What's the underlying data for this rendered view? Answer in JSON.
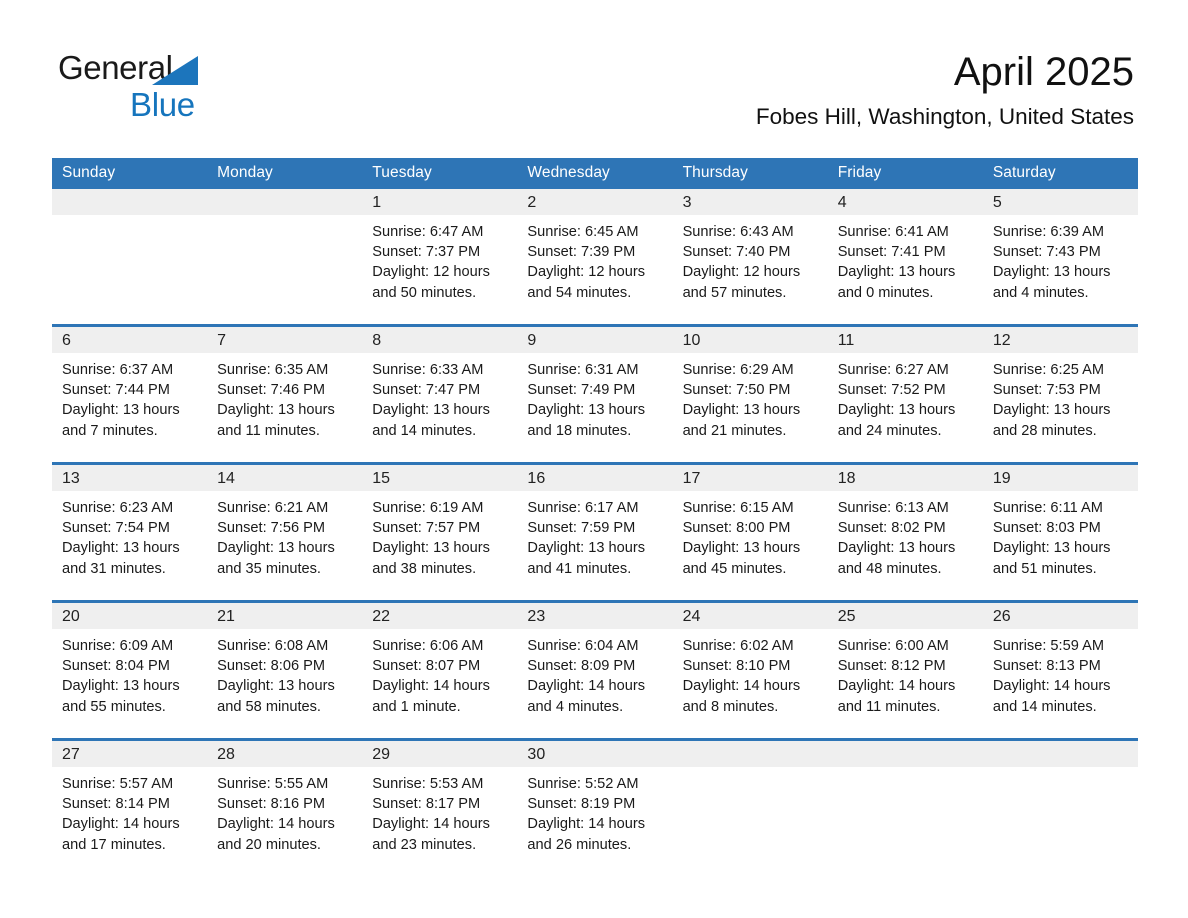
{
  "brand": {
    "name_part1": "General",
    "name_part2": "Blue",
    "triangle_color": "#1c75bc",
    "blue_color": "#1675bd"
  },
  "header": {
    "title": "April 2025",
    "subtitle": "Fobes Hill, Washington, United States"
  },
  "theme": {
    "header_blue": "#2e75b6",
    "daynum_band": "#efefef",
    "text": "#1a1a1a",
    "page_background": "#ffffff"
  },
  "weekday_headers": [
    "Sunday",
    "Monday",
    "Tuesday",
    "Wednesday",
    "Thursday",
    "Friday",
    "Saturday"
  ],
  "weeks": [
    [
      {
        "day": "",
        "sunrise": "",
        "sunset": "",
        "daylight_line1": "",
        "daylight_line2": ""
      },
      {
        "day": "",
        "sunrise": "",
        "sunset": "",
        "daylight_line1": "",
        "daylight_line2": ""
      },
      {
        "day": "1",
        "sunrise": "Sunrise: 6:47 AM",
        "sunset": "Sunset: 7:37 PM",
        "daylight_line1": "Daylight: 12 hours",
        "daylight_line2": "and 50 minutes."
      },
      {
        "day": "2",
        "sunrise": "Sunrise: 6:45 AM",
        "sunset": "Sunset: 7:39 PM",
        "daylight_line1": "Daylight: 12 hours",
        "daylight_line2": "and 54 minutes."
      },
      {
        "day": "3",
        "sunrise": "Sunrise: 6:43 AM",
        "sunset": "Sunset: 7:40 PM",
        "daylight_line1": "Daylight: 12 hours",
        "daylight_line2": "and 57 minutes."
      },
      {
        "day": "4",
        "sunrise": "Sunrise: 6:41 AM",
        "sunset": "Sunset: 7:41 PM",
        "daylight_line1": "Daylight: 13 hours",
        "daylight_line2": "and 0 minutes."
      },
      {
        "day": "5",
        "sunrise": "Sunrise: 6:39 AM",
        "sunset": "Sunset: 7:43 PM",
        "daylight_line1": "Daylight: 13 hours",
        "daylight_line2": "and 4 minutes."
      }
    ],
    [
      {
        "day": "6",
        "sunrise": "Sunrise: 6:37 AM",
        "sunset": "Sunset: 7:44 PM",
        "daylight_line1": "Daylight: 13 hours",
        "daylight_line2": "and 7 minutes."
      },
      {
        "day": "7",
        "sunrise": "Sunrise: 6:35 AM",
        "sunset": "Sunset: 7:46 PM",
        "daylight_line1": "Daylight: 13 hours",
        "daylight_line2": "and 11 minutes."
      },
      {
        "day": "8",
        "sunrise": "Sunrise: 6:33 AM",
        "sunset": "Sunset: 7:47 PM",
        "daylight_line1": "Daylight: 13 hours",
        "daylight_line2": "and 14 minutes."
      },
      {
        "day": "9",
        "sunrise": "Sunrise: 6:31 AM",
        "sunset": "Sunset: 7:49 PM",
        "daylight_line1": "Daylight: 13 hours",
        "daylight_line2": "and 18 minutes."
      },
      {
        "day": "10",
        "sunrise": "Sunrise: 6:29 AM",
        "sunset": "Sunset: 7:50 PM",
        "daylight_line1": "Daylight: 13 hours",
        "daylight_line2": "and 21 minutes."
      },
      {
        "day": "11",
        "sunrise": "Sunrise: 6:27 AM",
        "sunset": "Sunset: 7:52 PM",
        "daylight_line1": "Daylight: 13 hours",
        "daylight_line2": "and 24 minutes."
      },
      {
        "day": "12",
        "sunrise": "Sunrise: 6:25 AM",
        "sunset": "Sunset: 7:53 PM",
        "daylight_line1": "Daylight: 13 hours",
        "daylight_line2": "and 28 minutes."
      }
    ],
    [
      {
        "day": "13",
        "sunrise": "Sunrise: 6:23 AM",
        "sunset": "Sunset: 7:54 PM",
        "daylight_line1": "Daylight: 13 hours",
        "daylight_line2": "and 31 minutes."
      },
      {
        "day": "14",
        "sunrise": "Sunrise: 6:21 AM",
        "sunset": "Sunset: 7:56 PM",
        "daylight_line1": "Daylight: 13 hours",
        "daylight_line2": "and 35 minutes."
      },
      {
        "day": "15",
        "sunrise": "Sunrise: 6:19 AM",
        "sunset": "Sunset: 7:57 PM",
        "daylight_line1": "Daylight: 13 hours",
        "daylight_line2": "and 38 minutes."
      },
      {
        "day": "16",
        "sunrise": "Sunrise: 6:17 AM",
        "sunset": "Sunset: 7:59 PM",
        "daylight_line1": "Daylight: 13 hours",
        "daylight_line2": "and 41 minutes."
      },
      {
        "day": "17",
        "sunrise": "Sunrise: 6:15 AM",
        "sunset": "Sunset: 8:00 PM",
        "daylight_line1": "Daylight: 13 hours",
        "daylight_line2": "and 45 minutes."
      },
      {
        "day": "18",
        "sunrise": "Sunrise: 6:13 AM",
        "sunset": "Sunset: 8:02 PM",
        "daylight_line1": "Daylight: 13 hours",
        "daylight_line2": "and 48 minutes."
      },
      {
        "day": "19",
        "sunrise": "Sunrise: 6:11 AM",
        "sunset": "Sunset: 8:03 PM",
        "daylight_line1": "Daylight: 13 hours",
        "daylight_line2": "and 51 minutes."
      }
    ],
    [
      {
        "day": "20",
        "sunrise": "Sunrise: 6:09 AM",
        "sunset": "Sunset: 8:04 PM",
        "daylight_line1": "Daylight: 13 hours",
        "daylight_line2": "and 55 minutes."
      },
      {
        "day": "21",
        "sunrise": "Sunrise: 6:08 AM",
        "sunset": "Sunset: 8:06 PM",
        "daylight_line1": "Daylight: 13 hours",
        "daylight_line2": "and 58 minutes."
      },
      {
        "day": "22",
        "sunrise": "Sunrise: 6:06 AM",
        "sunset": "Sunset: 8:07 PM",
        "daylight_line1": "Daylight: 14 hours",
        "daylight_line2": "and 1 minute."
      },
      {
        "day": "23",
        "sunrise": "Sunrise: 6:04 AM",
        "sunset": "Sunset: 8:09 PM",
        "daylight_line1": "Daylight: 14 hours",
        "daylight_line2": "and 4 minutes."
      },
      {
        "day": "24",
        "sunrise": "Sunrise: 6:02 AM",
        "sunset": "Sunset: 8:10 PM",
        "daylight_line1": "Daylight: 14 hours",
        "daylight_line2": "and 8 minutes."
      },
      {
        "day": "25",
        "sunrise": "Sunrise: 6:00 AM",
        "sunset": "Sunset: 8:12 PM",
        "daylight_line1": "Daylight: 14 hours",
        "daylight_line2": "and 11 minutes."
      },
      {
        "day": "26",
        "sunrise": "Sunrise: 5:59 AM",
        "sunset": "Sunset: 8:13 PM",
        "daylight_line1": "Daylight: 14 hours",
        "daylight_line2": "and 14 minutes."
      }
    ],
    [
      {
        "day": "27",
        "sunrise": "Sunrise: 5:57 AM",
        "sunset": "Sunset: 8:14 PM",
        "daylight_line1": "Daylight: 14 hours",
        "daylight_line2": "and 17 minutes."
      },
      {
        "day": "28",
        "sunrise": "Sunrise: 5:55 AM",
        "sunset": "Sunset: 8:16 PM",
        "daylight_line1": "Daylight: 14 hours",
        "daylight_line2": "and 20 minutes."
      },
      {
        "day": "29",
        "sunrise": "Sunrise: 5:53 AM",
        "sunset": "Sunset: 8:17 PM",
        "daylight_line1": "Daylight: 14 hours",
        "daylight_line2": "and 23 minutes."
      },
      {
        "day": "30",
        "sunrise": "Sunrise: 5:52 AM",
        "sunset": "Sunset: 8:19 PM",
        "daylight_line1": "Daylight: 14 hours",
        "daylight_line2": "and 26 minutes."
      },
      {
        "day": "",
        "sunrise": "",
        "sunset": "",
        "daylight_line1": "",
        "daylight_line2": ""
      },
      {
        "day": "",
        "sunrise": "",
        "sunset": "",
        "daylight_line1": "",
        "daylight_line2": ""
      },
      {
        "day": "",
        "sunrise": "",
        "sunset": "",
        "daylight_line1": "",
        "daylight_line2": ""
      }
    ]
  ]
}
